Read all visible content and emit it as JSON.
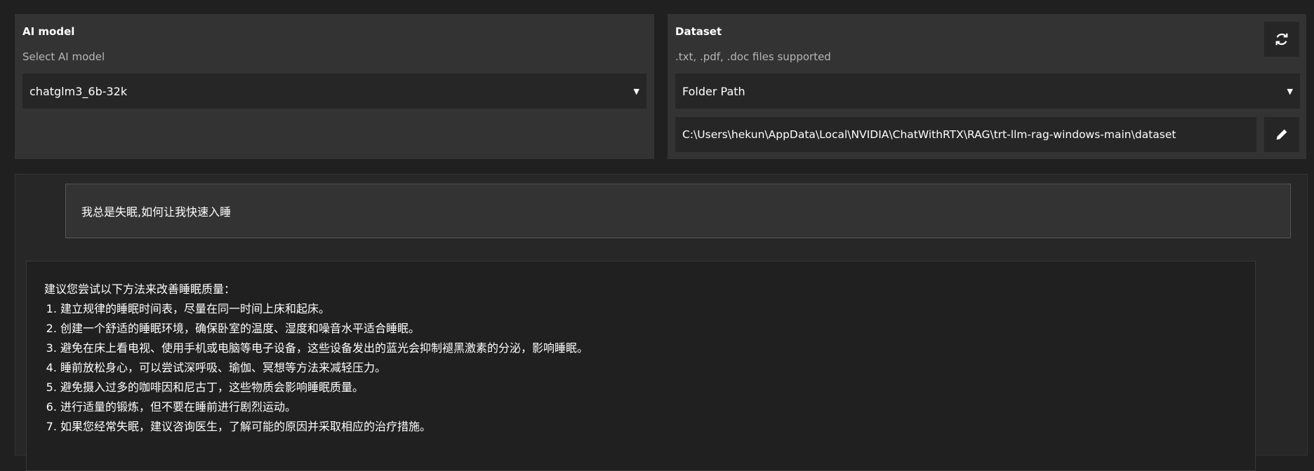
{
  "model_panel": {
    "title": "AI model",
    "subtitle": "Select AI model",
    "selected_model": "chatglm3_6b-32k"
  },
  "dataset_panel": {
    "title": "Dataset",
    "subtitle": ".txt, .pdf, .doc files supported",
    "source_type": "Folder Path",
    "folder_path": "C:\\Users\\hekun\\AppData\\Local\\NVIDIA\\ChatWithRTX\\RAG\\trt-llm-rag-windows-main\\dataset",
    "icons": {
      "refresh": "refresh-icon",
      "edit": "pencil-icon"
    }
  },
  "chat": {
    "user_message": "我总是失眠,如何让我快速入睡",
    "bot_intro": "建议您尝试以下方法来改善睡眠质量：",
    "bot_items": [
      "建立规律的睡眠时间表，尽量在同一时间上床和起床。",
      "创建一个舒适的睡眠环境，确保卧室的温度、湿度和噪音水平适合睡眠。",
      "避免在床上看电视、使用手机或电脑等电子设备，这些设备发出的蓝光会抑制褪黑激素的分泌，影响睡眠。",
      "睡前放松身心，可以尝试深呼吸、瑜伽、冥想等方法来减轻压力。",
      "避免摄入过多的咖啡因和尼古丁，这些物质会影响睡眠质量。",
      "进行适量的锻炼，但不要在睡前进行剧烈运动。",
      "如果您经常失眠，建议咨询医生，了解可能的原因并采取相应的治疗措施。"
    ]
  }
}
